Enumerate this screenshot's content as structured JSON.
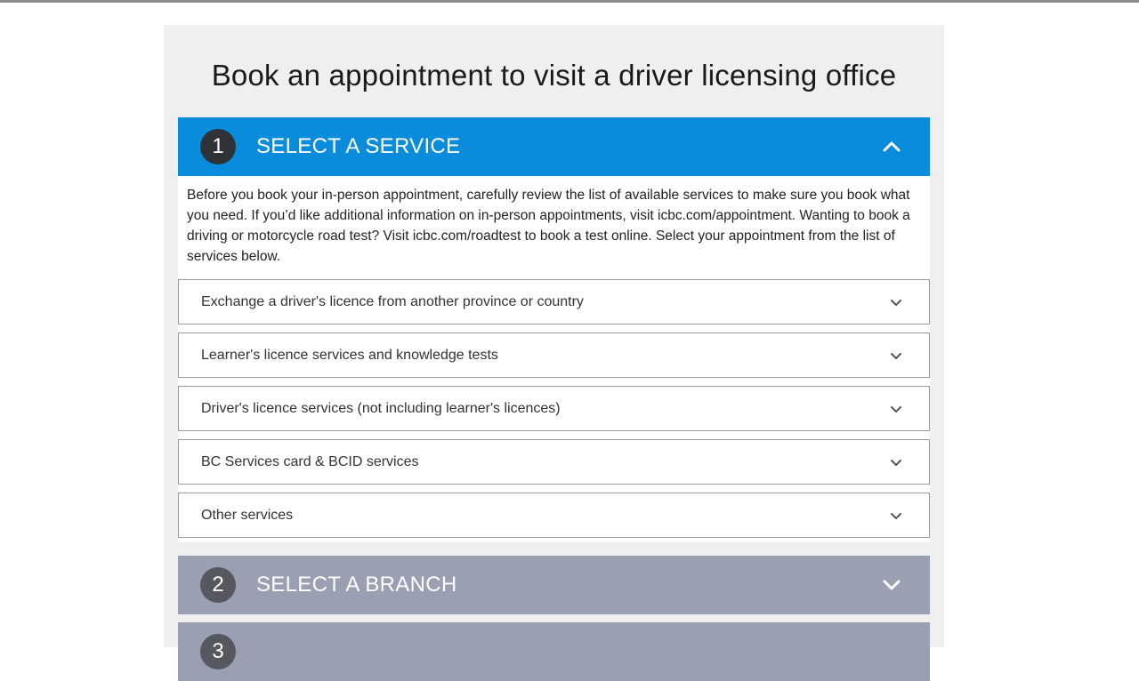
{
  "page": {
    "title": "Book an appointment to visit a driver licensing office"
  },
  "steps": [
    {
      "number": "1",
      "label": "SELECT A SERVICE",
      "state": "expanded",
      "intro": "Before you book your in-person appointment, carefully review the list of available services to make sure you book what you need. If you’d like additional information on in-person appointments, visit icbc.com/appointment. Wanting to book a driving or motorcycle road test? Visit icbc.com/roadtest to book a test online. Select your appointment from the list of services below.",
      "services": [
        {
          "label": "Exchange a driver's licence from another province or country"
        },
        {
          "label": "Learner's licence services and knowledge tests"
        },
        {
          "label": "Driver's licence services (not including learner's licences)"
        },
        {
          "label": "BC Services card & BCID services"
        },
        {
          "label": "Other services"
        }
      ]
    },
    {
      "number": "2",
      "label": "SELECT A BRANCH",
      "state": "collapsed"
    },
    {
      "number": "3",
      "label": "",
      "state": "collapsed"
    }
  ],
  "colors": {
    "active_header": "#0a8cdc",
    "inactive_header": "#9b9fb2",
    "panel_bg": "#efefef"
  },
  "icons": {
    "expanded": "chevron-up-icon",
    "collapsed": "chevron-down-icon"
  }
}
